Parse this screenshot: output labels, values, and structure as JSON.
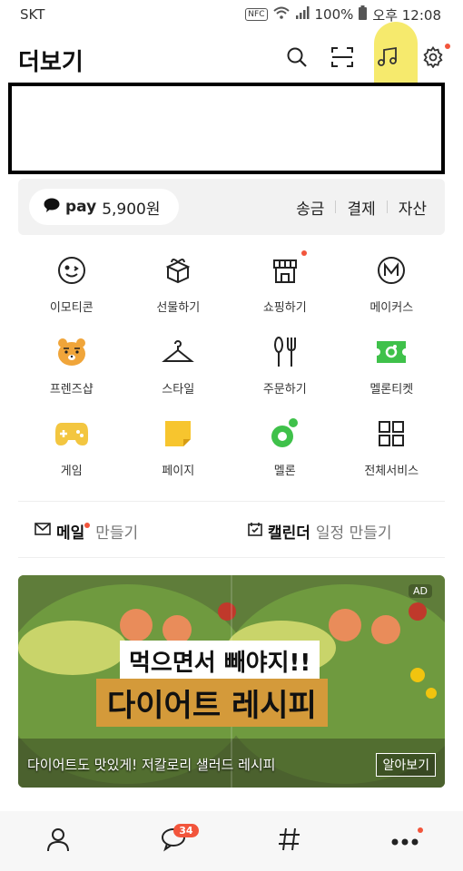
{
  "status_bar": {
    "carrier": "SKT",
    "nfc": "NFC",
    "battery": "100%",
    "time": "오후 12:08"
  },
  "header": {
    "title": "더보기"
  },
  "pay": {
    "brand": "pay",
    "balance": "5,900원",
    "links": [
      "송금",
      "결제",
      "자산"
    ]
  },
  "services": [
    {
      "label": "이모티콘",
      "icon": "emoticon-icon"
    },
    {
      "label": "선물하기",
      "icon": "gift-icon"
    },
    {
      "label": "쇼핑하기",
      "icon": "shop-icon"
    },
    {
      "label": "메이커스",
      "icon": "makers-icon"
    },
    {
      "label": "프렌즈샵",
      "icon": "friends-icon"
    },
    {
      "label": "스타일",
      "icon": "hanger-icon"
    },
    {
      "label": "주문하기",
      "icon": "fork-knife-icon"
    },
    {
      "label": "멜론티켓",
      "icon": "ticket-icon"
    },
    {
      "label": "게임",
      "icon": "gamepad-icon"
    },
    {
      "label": "페이지",
      "icon": "page-icon"
    },
    {
      "label": "멜론",
      "icon": "melon-icon"
    },
    {
      "label": "전체서비스",
      "icon": "grid-icon"
    }
  ],
  "quick": {
    "mail": {
      "label": "메일",
      "sub": "만들기"
    },
    "calendar": {
      "label": "캘린더",
      "sub": "일정 만들기"
    }
  },
  "ad": {
    "tag": "AD",
    "headline1": "먹으면서 빼야지!!",
    "headline2": "다이어트 레시피",
    "caption": "다이어트도 맛있게! 저칼로리 샐러드 레시피",
    "cta": "알아보기"
  },
  "tabbar": {
    "chat_badge": "34"
  },
  "colors": {
    "accent_red": "#f2553c",
    "highlight_yellow": "#f5e653",
    "melon_green": "#3fc14a",
    "ryan_orange": "#f0a53a"
  }
}
